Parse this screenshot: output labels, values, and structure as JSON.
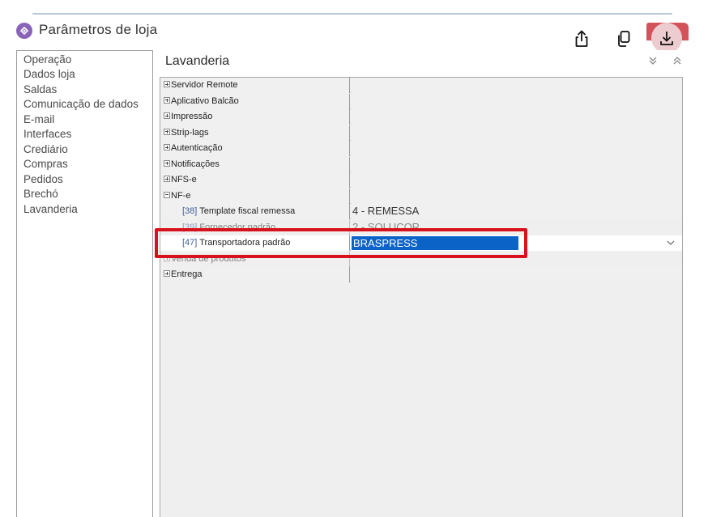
{
  "window": {
    "title": "Parâmetros de loja",
    "app_icon": "store-settings-icon"
  },
  "overlay_toolbar": {
    "share_icon": "share-icon",
    "copy_icon": "copy-icon",
    "download_icon": "download-icon",
    "accent_color": "#d4535b"
  },
  "sidebar": {
    "items": [
      {
        "label": "Operação"
      },
      {
        "label": "Dados loja"
      },
      {
        "label": "Saldas"
      },
      {
        "label": "Comunicação de dados"
      },
      {
        "label": "E-mail"
      },
      {
        "label": "Interfaces"
      },
      {
        "label": "Crediário"
      },
      {
        "label": "Compras"
      },
      {
        "label": "Pedidos"
      },
      {
        "label": "Brechó"
      },
      {
        "label": "Lavanderia"
      }
    ]
  },
  "panel": {
    "title": "Lavanderia"
  },
  "property_grid": {
    "groups": [
      {
        "label": "Servidor Remote",
        "state": "collapsed"
      },
      {
        "label": "Aplicativo Balcão",
        "state": "collapsed"
      },
      {
        "label": "Impressão",
        "state": "collapsed"
      },
      {
        "label": "Strip-lags",
        "state": "collapsed"
      },
      {
        "label": "Autenticação",
        "state": "collapsed"
      },
      {
        "label": "Notificações",
        "state": "collapsed"
      },
      {
        "label": "NFS-e",
        "state": "collapsed"
      },
      {
        "label": "NF-e",
        "state": "expanded"
      }
    ],
    "nfe_items": [
      {
        "id": "[38]",
        "label": "Template fiscal remessa",
        "value": "4 - REMESSA"
      },
      {
        "id": "[39]",
        "label": "Fornecedor padrão",
        "value": "2 - SOLUCOR"
      },
      {
        "id": "[47]",
        "label": "Transportadora padrão",
        "value": "BRASPRESS"
      }
    ],
    "after_groups": [
      {
        "label": "Venda de produtos",
        "state": "collapsed"
      },
      {
        "label": "Entrega",
        "state": "collapsed"
      }
    ],
    "highlight_color": "#d8121c",
    "selection_color": "#0b63c7"
  }
}
